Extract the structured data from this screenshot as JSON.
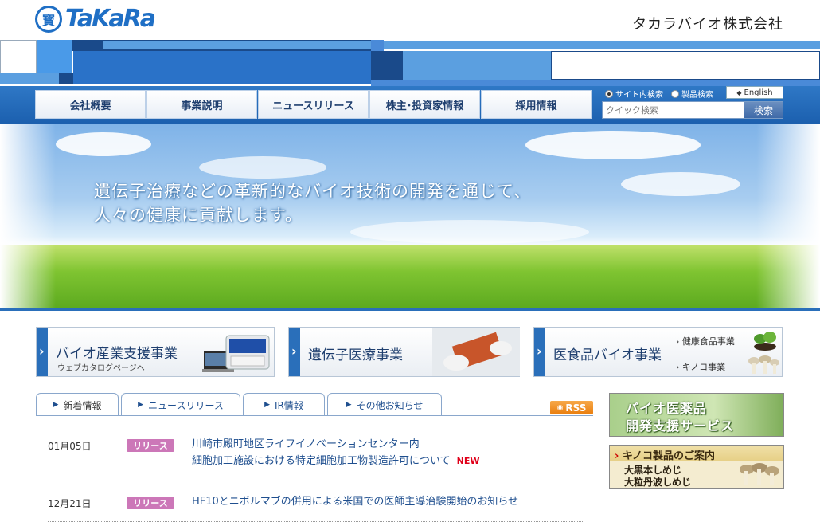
{
  "header": {
    "logo_mark": "寳",
    "logo_text": "TaKaRa",
    "company_name": "タカラバイオ株式会社"
  },
  "nav": {
    "items": [
      "会社概要",
      "事業説明",
      "ニュースリリース",
      "株主･投資家情報",
      "採用情報"
    ]
  },
  "search": {
    "option_site": "サイト内検索",
    "option_product": "製品検索",
    "english_label": "English",
    "placeholder": "クイック検索",
    "button_label": "検索"
  },
  "hero": {
    "line1": "遺伝子治療などの革新的なバイオ技術の開発を通じて、",
    "line2": "人々の健康に貢献します。"
  },
  "business": {
    "bio_industry": {
      "title": "バイオ産業支援事業",
      "subtitle": "ウェブカタログページへ"
    },
    "gene_medicine": {
      "title": "遺伝子医療事業"
    },
    "medical_food": {
      "title": "医食品バイオ事業",
      "side1": "健康食品事業",
      "side2": "キノコ事業"
    }
  },
  "tabs": [
    "新着情報",
    "ニュースリリース",
    "IR情報",
    "その他お知らせ"
  ],
  "rss_label": "RSS",
  "news": [
    {
      "date": "01月05日",
      "tag": "リリース",
      "line1": "川崎市殿町地区ライフイノベーションセンター内",
      "line2": "細胞加工施設における特定細胞加工物製造許可について",
      "new_label": "NEW"
    },
    {
      "date": "12月21日",
      "tag": "リリース",
      "line1": "HF10とニボルマブの併用による米国での医師主導治験開始のお知らせ"
    }
  ],
  "banners": {
    "bio_drug": {
      "line1": "バイオ医薬品",
      "line2": "開発支援サービス"
    },
    "mushroom": {
      "heading": "キノコ製品のご案内",
      "line1": "大黒本しめじ",
      "line2": "大粒丹波しめじ"
    }
  },
  "colors": {
    "brand_blue": "#1f6fc5",
    "nav_blue": "#2a6fba",
    "tag_pink": "#cc77b8",
    "rss_orange": "#e97d0d",
    "new_red": "#e0001a"
  }
}
